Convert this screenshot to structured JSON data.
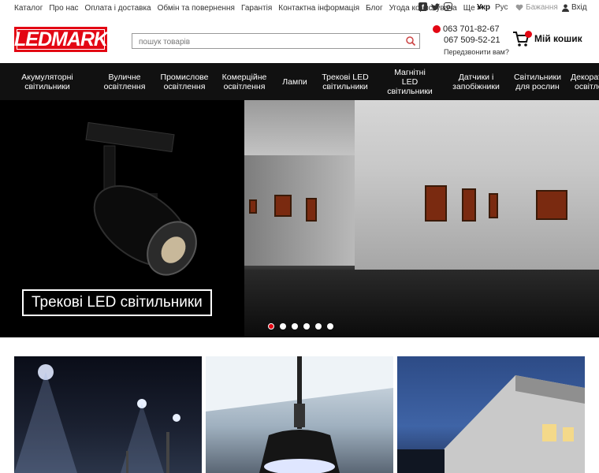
{
  "topbar": {
    "links": [
      "Каталог",
      "Про нас",
      "Оплата і доставка",
      "Обмін та повернення",
      "Гарантія",
      "Контактна інформація",
      "Блог",
      "Угода користувача"
    ],
    "more_label": "Ще",
    "languages": {
      "active": "Укр",
      "inactive": "Рус"
    },
    "wishlist_label": "Бажання",
    "login_label": "Вхід"
  },
  "header": {
    "logo_text": "LEDMARK",
    "search_placeholder": "пошук товарів",
    "phone1": "063 701-82-67",
    "phone2": "067 509-52-21",
    "callback_label": "Передзвонити вам?",
    "cart_label": "Мій кошик"
  },
  "nav": {
    "items": [
      {
        "line1": "Акумуляторні",
        "line2": "світильники",
        "line3": ""
      },
      {
        "line1": "Вуличне",
        "line2": "освітлення",
        "line3": ""
      },
      {
        "line1": "Промислове",
        "line2": "освітлення",
        "line3": ""
      },
      {
        "line1": "Комерційне",
        "line2": "освітлення",
        "line3": ""
      },
      {
        "line1": "Лампи",
        "line2": "",
        "line3": ""
      },
      {
        "line1": "Трекові LED",
        "line2": "світильники",
        "line3": ""
      },
      {
        "line1": "Магнітні",
        "line2": "LED",
        "line3": "світильники"
      },
      {
        "line1": "Датчики і",
        "line2": "запобіжники",
        "line3": ""
      },
      {
        "line1": "Світильники",
        "line2": "для рослин",
        "line3": ""
      },
      {
        "line1": "Декоративне",
        "line2": "освітлення",
        "line3": ""
      }
    ]
  },
  "slider": {
    "caption": "Трекові LED світильники",
    "active_index": 0,
    "count": 6
  },
  "colors": {
    "brand_red": "#e30613",
    "nav_bg": "#111111"
  }
}
